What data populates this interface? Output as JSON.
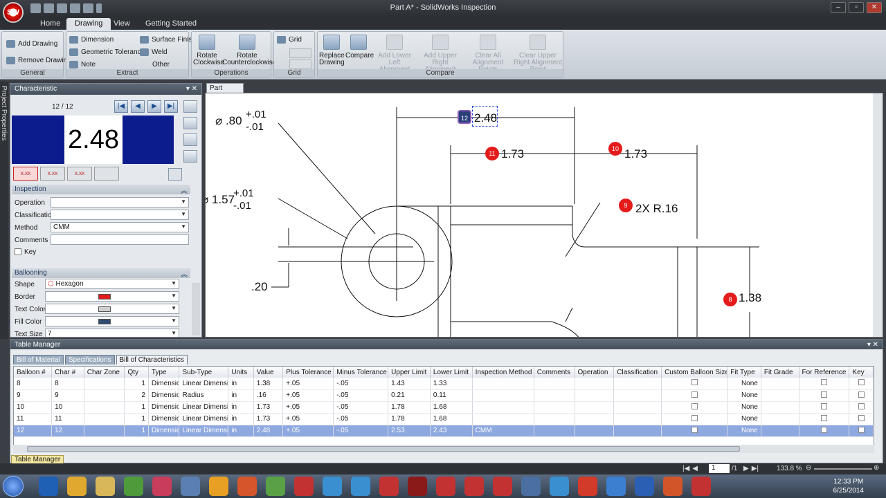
{
  "window": {
    "title": "Part A* - SolidWorks Inspection",
    "logo_text": "SW"
  },
  "tabs": [
    "Home",
    "Drawing",
    "View",
    "Getting Started"
  ],
  "ribbon": {
    "general": {
      "name": "General",
      "add_drawing": "Add Drawing",
      "remove_drawing": "Remove Drawing"
    },
    "extract": {
      "name": "Extract",
      "dimension": "Dimension",
      "geometric_tolerance": "Geometric Tolerance",
      "note": "Note",
      "surface_finish": "Surface Finish",
      "weld": "Weld",
      "other": "Other"
    },
    "operations": {
      "name": "Operations",
      "rotate_cw": "Rotate Clockwise",
      "rotate_ccw": "Rotate Counterclockwise"
    },
    "grid": {
      "name": "Grid",
      "grid_label": "Grid"
    },
    "compare": {
      "name": "Compare",
      "replace_drawing": "Replace Drawing",
      "compare": "Compare",
      "add_lower_left": "Add Lower Left Alignment Point",
      "add_upper_right": "Add Upper Right Alignment Point",
      "clear_all": "Clear All Alignment Points",
      "clear_upper_right": "Clear Upper Right Alignment Point"
    }
  },
  "side_strip_label": "Project Properties",
  "characteristic": {
    "title": "Characteristic",
    "count": "12 / 12",
    "value": "2.48",
    "inspection": {
      "title": "Inspection",
      "operation_label": "Operation",
      "operation_value": "",
      "classification_label": "Classification",
      "classification_value": "",
      "method_label": "Method",
      "method_value": "CMM",
      "comments_label": "Comments",
      "comments_value": "",
      "key_label": "Key"
    },
    "ballooning": {
      "title": "Ballooning",
      "shape_label": "Shape",
      "shape_value": "Hexagon",
      "border_label": "Border",
      "border_color": "#e21b1b",
      "text_color_label": "Text Color",
      "text_color": "#cfcfcf",
      "fill_color_label": "Fill Color",
      "fill_color": "#2f4a72",
      "text_size_label": "Text Size",
      "text_size_value": "7"
    }
  },
  "drawing": {
    "tab": "Part A.PDF",
    "labels": {
      "dia_80": "⌀ .80",
      "dia_80_plus": "+.01",
      "dia_80_minus": "-.01",
      "dia_157": "⌀ 1.57",
      "dia_157_plus": "+.01",
      "dia_157_minus": "-.01",
      "d_20": ".20",
      "d_248": "2.48",
      "d_173a": "1.73",
      "d_173b": "1.73",
      "d_r16": "2X R.16",
      "d_138": "1.38"
    },
    "balloons": [
      "12",
      "11",
      "10",
      "9",
      "8"
    ]
  },
  "table_manager": {
    "title": "Table Manager",
    "tabs": [
      "Bill of Material",
      "Specifications",
      "Bill of Characteristics"
    ],
    "columns": [
      "Balloon #",
      "Char #",
      "Char Zone",
      "Qty",
      "Type",
      "Sub-Type",
      "Units",
      "Value",
      "Plus Tolerance",
      "Minus Tolerance",
      "Upper Limit",
      "Lower Limit",
      "Inspection Method",
      "Comments",
      "Operation",
      "Classification",
      "Custom Balloon Size",
      "Fit Type",
      "Fit Grade",
      "For Reference",
      "Key"
    ],
    "rows": [
      {
        "balloon": "8",
        "char": "8",
        "zone": "",
        "qty": "1",
        "type": "Dimension",
        "subtype": "Linear Dimension",
        "units": "in",
        "value": "1.38",
        "plus": "+.05",
        "minus": "-.05",
        "upper": "1.43",
        "lower": "1.33",
        "method": "",
        "fit_type": "None"
      },
      {
        "balloon": "9",
        "char": "9",
        "zone": "",
        "qty": "2",
        "type": "Dimension",
        "subtype": "Radius",
        "units": "in",
        "value": ".16",
        "plus": "+.05",
        "minus": "-.05",
        "upper": "0.21",
        "lower": "0.11",
        "method": "",
        "fit_type": "None"
      },
      {
        "balloon": "10",
        "char": "10",
        "zone": "",
        "qty": "1",
        "type": "Dimension",
        "subtype": "Linear Dimension",
        "units": "in",
        "value": "1.73",
        "plus": "+.05",
        "minus": "-.05",
        "upper": "1.78",
        "lower": "1.68",
        "method": "",
        "fit_type": "None"
      },
      {
        "balloon": "11",
        "char": "11",
        "zone": "",
        "qty": "1",
        "type": "Dimension",
        "subtype": "Linear Dimension",
        "units": "in",
        "value": "1.73",
        "plus": "+.05",
        "minus": "-.05",
        "upper": "1.78",
        "lower": "1.68",
        "method": "",
        "fit_type": "None"
      },
      {
        "balloon": "12",
        "char": "12",
        "zone": "",
        "qty": "1",
        "type": "Dimension",
        "subtype": "Linear Dimension",
        "units": "in",
        "value": "2.48",
        "plus": "+.05",
        "minus": "-.05",
        "upper": "2.53",
        "lower": "2.43",
        "method": "CMM",
        "fit_type": "None"
      }
    ],
    "footer_tab": "Table Manager"
  },
  "statusbar": {
    "page": "1",
    "page_total": "/1",
    "zoom": "133.8 %"
  },
  "clock": {
    "time": "12:33 PM",
    "date": "6/25/2014"
  }
}
